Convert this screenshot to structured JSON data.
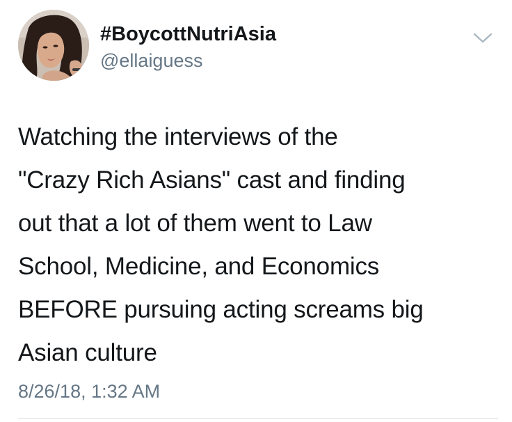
{
  "tweet": {
    "display_name": "#BoycottNutriAsia",
    "handle": "@ellaiguess",
    "text_lines": [
      "Watching the interviews of the",
      "\"Crazy Rich Asians\" cast and finding",
      "out that a lot of them went to Law",
      "School, Medicine, and Economics",
      "BEFORE pursuing acting screams big",
      "Asian culture"
    ],
    "timestamp": "8/26/18, 1:32 AM"
  },
  "icons": {
    "menu": "chevron-down-icon",
    "avatar": "profile-photo"
  },
  "colors": {
    "text": "#14171a",
    "secondary": "#657786",
    "divider": "#d8dde2",
    "caret": "#aab8c2"
  }
}
